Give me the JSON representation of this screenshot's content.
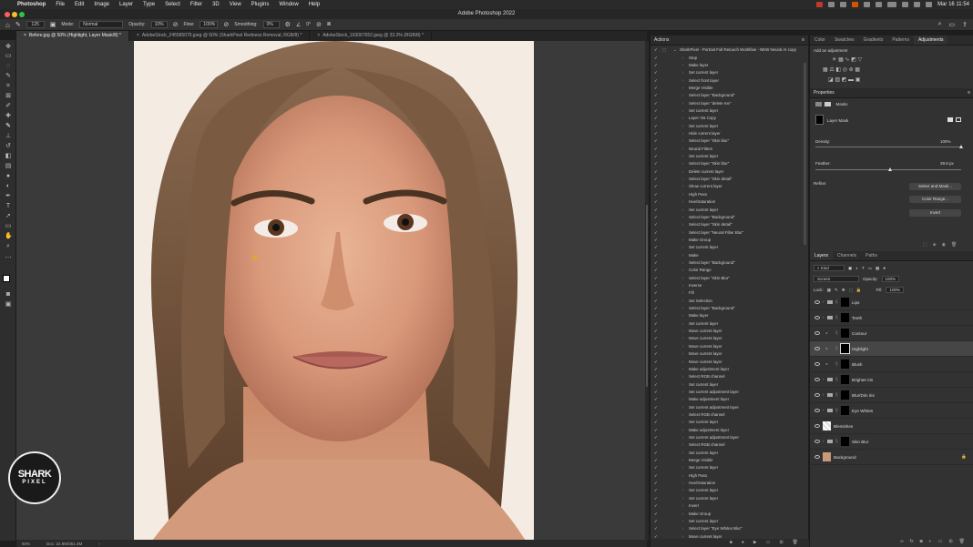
{
  "menubar": {
    "app": "Photoshop",
    "items": [
      "File",
      "Edit",
      "Image",
      "Layer",
      "Type",
      "Select",
      "Filter",
      "3D",
      "View",
      "Plugins",
      "Window",
      "Help"
    ],
    "clock": "Mar 16  11:54"
  },
  "window_title": "Adobe Photoshop 2022",
  "options": {
    "brush_size": "125",
    "mode_label": "Mode:",
    "mode_value": "Normal",
    "opacity_label": "Opacity:",
    "opacity_value": "10%",
    "flow_label": "Flow:",
    "flow_value": "100%",
    "smoothing_label": "Smoothing:",
    "smoothing_value": "0%",
    "angle_value": "0°"
  },
  "tabs": [
    "Before.jpg @ 50% (Highlight, Layer Mask/8) *",
    "AdobeStock_245585075.jpeg @ 50% (SharkPixel Redness Removal, RGB/8) *",
    "AdobeStock_163067652.jpeg @ 33.3% (RGB/8) *"
  ],
  "status": {
    "zoom": "50%",
    "doc": "Doc: 22.8M/351.4M"
  },
  "watermark": {
    "line1": "SHARK",
    "line2": "PIXEL"
  },
  "actions_panel": {
    "title": "Actions",
    "set_title": "SharkPixel - Portrait Full Retouch Workflow - NEW Neural AI copy",
    "steps": [
      "Stop",
      "Make layer",
      "Set current layer",
      "Select front layer",
      "Merge Visible",
      "Select layer \"Background\"",
      "Select layer \"delete me\"",
      "Set current layer",
      "Layer Via Copy",
      "Set current layer",
      "Hide current layer",
      "Select layer \"Skin blur\"",
      "Neural Filters",
      "Set current layer",
      "Select layer \"Skin blur\"",
      "Delete current layer",
      "Select layer \"Skin detail\"",
      "Show current layer",
      "High Pass",
      "Hue/Saturation",
      "Set current layer",
      "Select layer \"Background\"",
      "Select layer \"Skin detail\"",
      "Select layer \"Neural Filter Blur\"",
      "Make Group",
      "Set current layer",
      "Make",
      "Select layer \"Background\"",
      "Color Range",
      "Select layer \"Skin Blur\"",
      "Inverse",
      "Fill",
      "Set Selection",
      "Select layer \"Background\"",
      "Make layer",
      "Set current layer",
      "Move current layer",
      "Move current layer",
      "Move current layer",
      "Move current layer",
      "Move current layer",
      "Make adjustment layer",
      "Select RGB channel",
      "Set current layer",
      "Set current adjustment layer",
      "Make adjustment layer",
      "Set current adjustment layer",
      "Select RGB channel",
      "Set current layer",
      "Make adjustment layer",
      "Set current adjustment layer",
      "Select RGB channel",
      "Set current layer",
      "Merge Visible",
      "Set current layer",
      "High Pass",
      "Hue/Saturation",
      "Set current layer",
      "Set current layer",
      "Invert",
      "Make Group",
      "Set current layer",
      "Select layer \"Eye Whites Blur\"",
      "Move current layer"
    ]
  },
  "right_tabs": [
    "Color",
    "Swatches",
    "Gradients",
    "Patterns",
    "Adjustments"
  ],
  "adjustments_label": "Add an adjustment",
  "properties": {
    "title": "Properties",
    "masks_label": "Masks",
    "layer_mask_label": "Layer Mask",
    "density_label": "Density:",
    "density_value": "100%",
    "feather_label": "Feather:",
    "feather_value": "39.8 px",
    "refine_label": "Refine:",
    "select_mask_btn": "Select and Mask...",
    "color_range_btn": "Color Range...",
    "invert_btn": "Invert"
  },
  "layers_panel": {
    "tabs": [
      "Layers",
      "Channels",
      "Paths"
    ],
    "kind_label": "Kind",
    "blend_mode": "Screen",
    "opacity_label": "Opacity:",
    "opacity_value": "100%",
    "lock_label": "Lock:",
    "fill_label": "Fill:",
    "fill_value": "100%",
    "layers": [
      {
        "name": "Lips"
      },
      {
        "name": "Teeth"
      },
      {
        "name": "Contour"
      },
      {
        "name": "Highlight"
      },
      {
        "name": "Blush"
      },
      {
        "name": "Brighter iris"
      },
      {
        "name": "Blur/Dim iris"
      },
      {
        "name": "Eye Whites"
      },
      {
        "name": "Blemishes"
      },
      {
        "name": "Skin Blur"
      },
      {
        "name": "Background"
      }
    ]
  }
}
